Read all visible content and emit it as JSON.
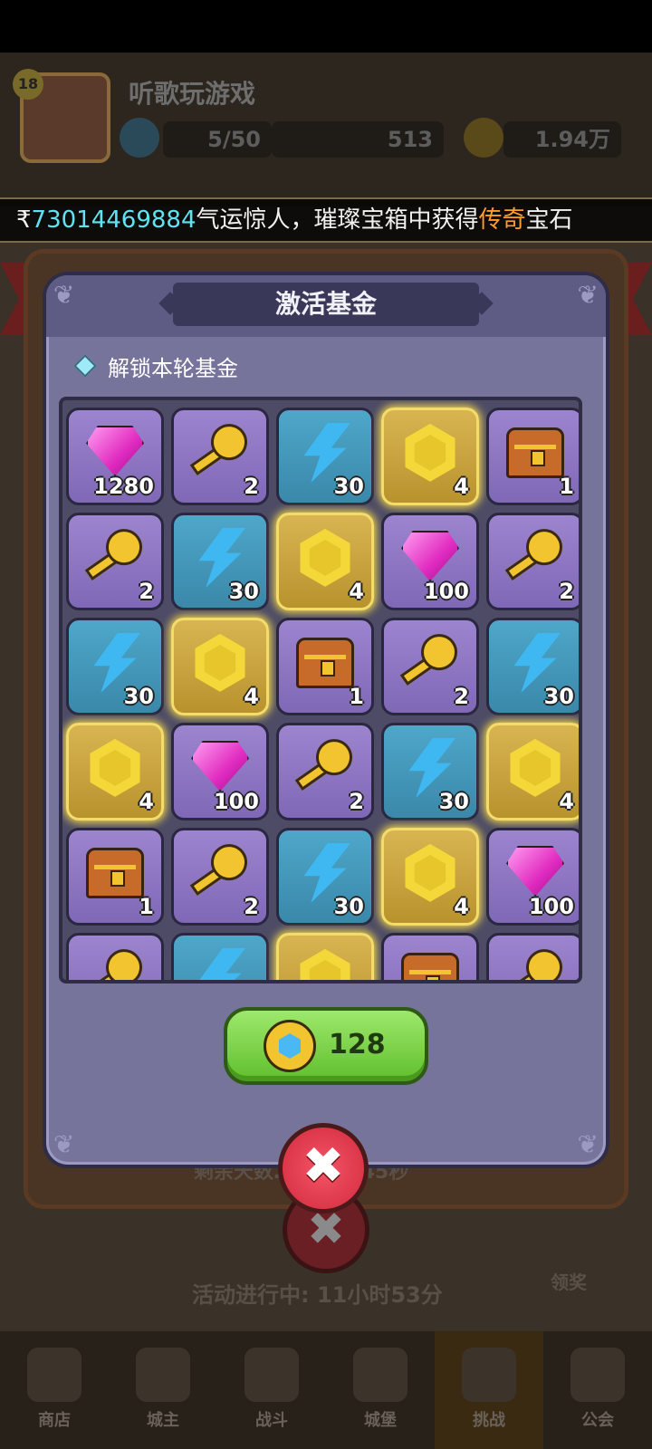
{
  "background": {
    "player_level": "18",
    "player_name": "听歌玩游戏",
    "energy": "5/50",
    "diamonds": "513",
    "gold": "1.94万",
    "event_countdown": "剩余天数…时55分45秒",
    "event_status": "活动进行中: 11小时53分",
    "claim_label": "领奖",
    "bottom_nav": [
      {
        "label": "商店",
        "icon": "shop-icon"
      },
      {
        "label": "城主",
        "icon": "crown-icon"
      },
      {
        "label": "战斗",
        "icon": "swords-icon"
      },
      {
        "label": "城堡",
        "icon": "castle-icon"
      },
      {
        "label": "挑战",
        "icon": "skull-icon"
      },
      {
        "label": "公会",
        "icon": "guild-icon"
      }
    ]
  },
  "ticker": {
    "id": "73014469884",
    "text_a": "气运惊人，璀璨宝箱中获得",
    "rarity": "传奇",
    "text_b": "宝石"
  },
  "dialog": {
    "title": "激活基金",
    "subtitle": "解锁本轮基金",
    "buy_price": "128",
    "close_symbol": "✖"
  },
  "rewards": [
    {
      "type": "gem",
      "qty": "1280",
      "bg": "purple"
    },
    {
      "type": "key",
      "qty": "2",
      "bg": "purple"
    },
    {
      "type": "bolt",
      "qty": "30",
      "bg": "blue"
    },
    {
      "type": "coin",
      "qty": "4",
      "bg": "gold"
    },
    {
      "type": "chest",
      "qty": "1",
      "bg": "purple"
    },
    {
      "type": "key",
      "qty": "2",
      "bg": "purple"
    },
    {
      "type": "bolt",
      "qty": "30",
      "bg": "blue"
    },
    {
      "type": "coin",
      "qty": "4",
      "bg": "gold"
    },
    {
      "type": "gem",
      "qty": "100",
      "bg": "purple"
    },
    {
      "type": "key",
      "qty": "2",
      "bg": "purple"
    },
    {
      "type": "bolt",
      "qty": "30",
      "bg": "blue"
    },
    {
      "type": "coin",
      "qty": "4",
      "bg": "gold"
    },
    {
      "type": "chest",
      "qty": "1",
      "bg": "purple"
    },
    {
      "type": "key",
      "qty": "2",
      "bg": "purple"
    },
    {
      "type": "bolt",
      "qty": "30",
      "bg": "blue"
    },
    {
      "type": "coin",
      "qty": "4",
      "bg": "gold"
    },
    {
      "type": "gem",
      "qty": "100",
      "bg": "purple"
    },
    {
      "type": "key",
      "qty": "2",
      "bg": "purple"
    },
    {
      "type": "bolt",
      "qty": "30",
      "bg": "blue"
    },
    {
      "type": "coin",
      "qty": "4",
      "bg": "gold"
    },
    {
      "type": "chest",
      "qty": "1",
      "bg": "purple"
    },
    {
      "type": "key",
      "qty": "2",
      "bg": "purple"
    },
    {
      "type": "bolt",
      "qty": "30",
      "bg": "blue"
    },
    {
      "type": "coin",
      "qty": "4",
      "bg": "gold"
    },
    {
      "type": "gem",
      "qty": "100",
      "bg": "purple"
    },
    {
      "type": "key",
      "qty": "",
      "bg": "purple"
    },
    {
      "type": "bolt",
      "qty": "",
      "bg": "blue"
    },
    {
      "type": "coin",
      "qty": "",
      "bg": "gold"
    },
    {
      "type": "chest",
      "qty": "",
      "bg": "purple"
    },
    {
      "type": "key",
      "qty": "",
      "bg": "purple"
    }
  ]
}
